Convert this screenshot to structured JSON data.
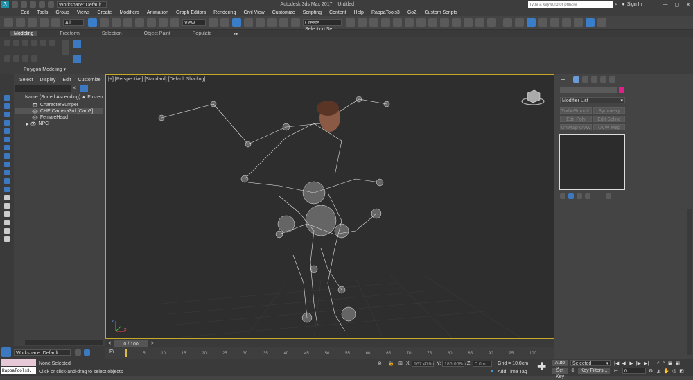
{
  "titlebar": {
    "workspace_label": "Workspace: Default",
    "title": "Autodesk 3ds Max 2017",
    "document": "Untitled",
    "search_placeholder": "Type a keyword or phrase",
    "sign_in": "Sign In"
  },
  "menu": [
    "Edit",
    "Tools",
    "Group",
    "Views",
    "Create",
    "Modifiers",
    "Animation",
    "Graph Editors",
    "Rendering",
    "Civil View",
    "Customize",
    "Scripting",
    "Content",
    "Help",
    "RappaTools3",
    "GoZ",
    "Custom Scripts"
  ],
  "toolbar": {
    "filter_all": "All",
    "view_dropdown": "View",
    "selection_set": "Create Selection Se"
  },
  "ribbon": {
    "tabs": [
      "Modeling",
      "Freeform",
      "Selection",
      "Object Paint",
      "Populate"
    ],
    "panel_label": "Polygon Modeling"
  },
  "scene_explorer": {
    "tabs": [
      "Select",
      "Display",
      "Edit",
      "Customize"
    ],
    "header_name": "Name (Sorted Ascending)",
    "header_frozen": "Frozen",
    "items": [
      "CharacterBumper",
      "CHE Camera3rd [Cam3]",
      "FemaleHead",
      "NPC"
    ]
  },
  "viewport": {
    "label": "[+] [Perspective] [Standard] [Default Shading]",
    "axis_x": "x",
    "axis_z": "z"
  },
  "command_panel": {
    "modifier_list": "Modifier List",
    "buttons": [
      "TurboSmooth",
      "Symmetry",
      "Edit Poly",
      "Edit Spline",
      "Unwrap UVW",
      "UVW Map"
    ],
    "accent_color": "#e0208a"
  },
  "timeline": {
    "frame_counter": "0 / 100",
    "ticks": [
      "0",
      "5",
      "10",
      "15",
      "20",
      "25",
      "30",
      "35",
      "40",
      "45",
      "50",
      "55",
      "60",
      "65",
      "70",
      "75",
      "80",
      "85",
      "90",
      "95",
      "100"
    ]
  },
  "status": {
    "workspace": "Workspace: Default",
    "script_listener": "RappaTools3.",
    "selection": "None Selected",
    "prompt": "Click or click-and-drag to select objects",
    "x_label": "X:",
    "x_value": "167.476m",
    "y_label": "Y:",
    "y_value": "186.008m",
    "z_label": "Z:",
    "z_value": "0.0m",
    "grid": "Grid = 10.0cm",
    "add_time_tag": "Add Time Tag",
    "auto_key": "Auto Key",
    "set_key": "Set Key",
    "selected_dropdown": "Selected",
    "key_filters": "Key Filters...",
    "current_frame": "0"
  }
}
